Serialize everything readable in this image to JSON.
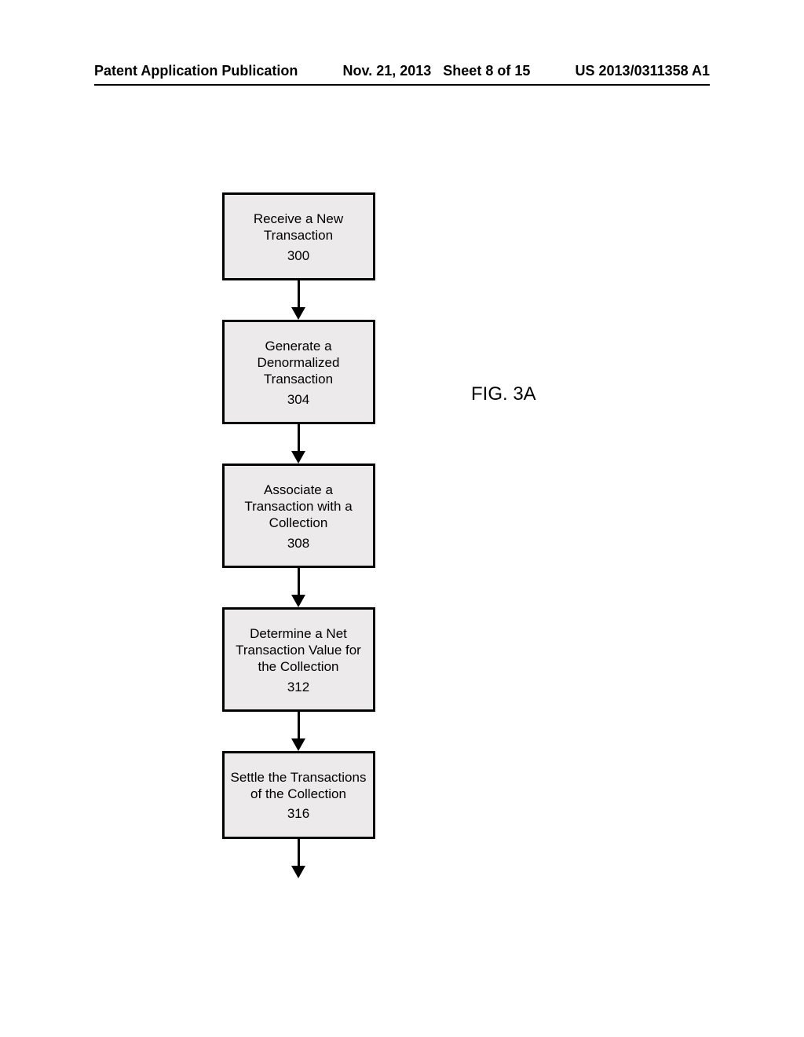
{
  "header": {
    "left": "Patent Application Publication",
    "mid_date": "Nov. 21, 2013",
    "mid_sheet": "Sheet 8 of 15",
    "right": "US 2013/0311358 A1"
  },
  "figure_label": "FIG. 3A",
  "steps": [
    {
      "text": "Receive a New Transaction",
      "ref": "300"
    },
    {
      "text": "Generate a Denormalized Transaction",
      "ref": "304"
    },
    {
      "text": "Associate a Transaction with a Collection",
      "ref": "308"
    },
    {
      "text": "Determine a Net Transaction Value for the Collection",
      "ref": "312"
    },
    {
      "text": "Settle the Transactions of the Collection",
      "ref": "316"
    }
  ]
}
